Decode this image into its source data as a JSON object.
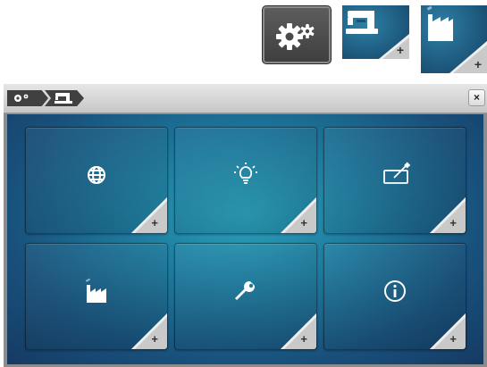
{
  "toolbar": {
    "settings_icon": "gears-icon",
    "sewing_icon": "sewing-machine-icon",
    "factory_icon": "factory-icon",
    "plus": "+"
  },
  "window": {
    "breadcrumb": [
      "settings",
      "sewing"
    ],
    "close_label": "×"
  },
  "tiles": [
    {
      "icon": "globe-icon",
      "plus": "+"
    },
    {
      "icon": "lightbulb-icon",
      "plus": "+"
    },
    {
      "icon": "touch-pen-icon",
      "plus": "+"
    },
    {
      "icon": "factory-icon",
      "plus": "+"
    },
    {
      "icon": "wrench-icon",
      "plus": "+"
    },
    {
      "icon": "info-icon",
      "plus": "+"
    }
  ],
  "colors": {
    "accent": "#1e7a9e",
    "panel_dark": "#153a62",
    "titlebar": "#d6d6d6"
  }
}
